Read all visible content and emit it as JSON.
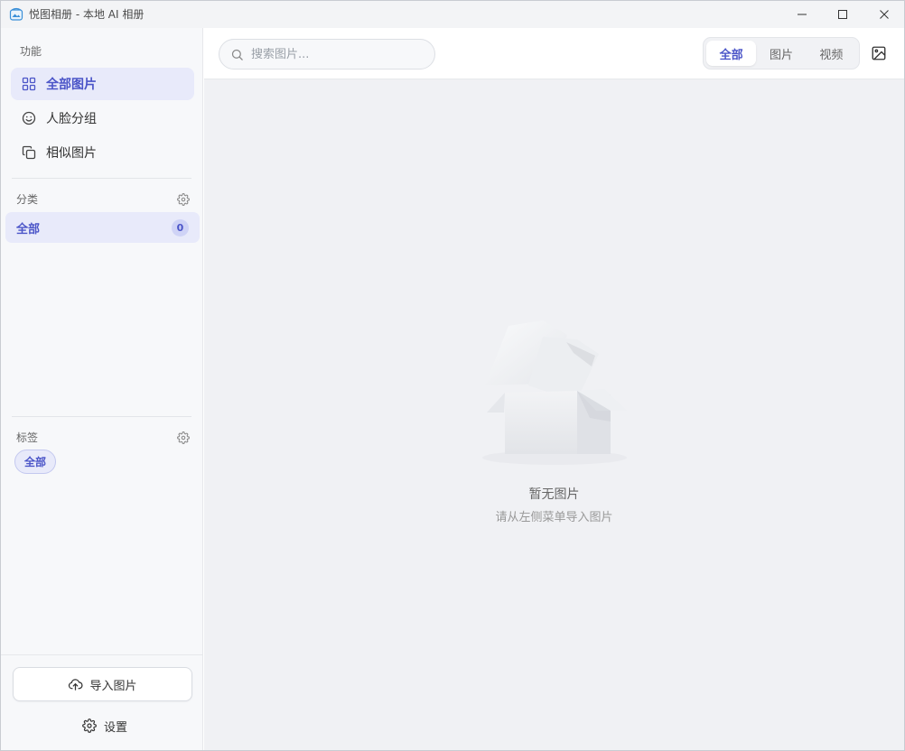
{
  "window": {
    "title": "悦图相册 - 本地 AI 相册"
  },
  "sidebar": {
    "function_label": "功能",
    "nav": [
      {
        "label": "全部图片",
        "icon": "grid-icon",
        "active": true
      },
      {
        "label": "人脸分组",
        "icon": "smile-icon",
        "active": false
      },
      {
        "label": "相似图片",
        "icon": "copy-icon",
        "active": false
      }
    ],
    "category_label": "分类",
    "category": {
      "label": "全部",
      "count": "0"
    },
    "tags_label": "标签",
    "tag": {
      "label": "全部"
    },
    "import_label": "导入图片",
    "settings_label": "设置"
  },
  "toolbar": {
    "search_placeholder": "搜索图片...",
    "filters": [
      {
        "label": "全部",
        "active": true
      },
      {
        "label": "图片",
        "active": false
      },
      {
        "label": "视频",
        "active": false
      }
    ]
  },
  "empty": {
    "title": "暂无图片",
    "subtitle": "请从左侧菜单导入图片"
  },
  "colors": {
    "accent": "#4b55c8",
    "accent_bg": "#e8eafa",
    "sidebar_bg": "#f7f8fa",
    "main_bg": "#f0f1f4"
  }
}
